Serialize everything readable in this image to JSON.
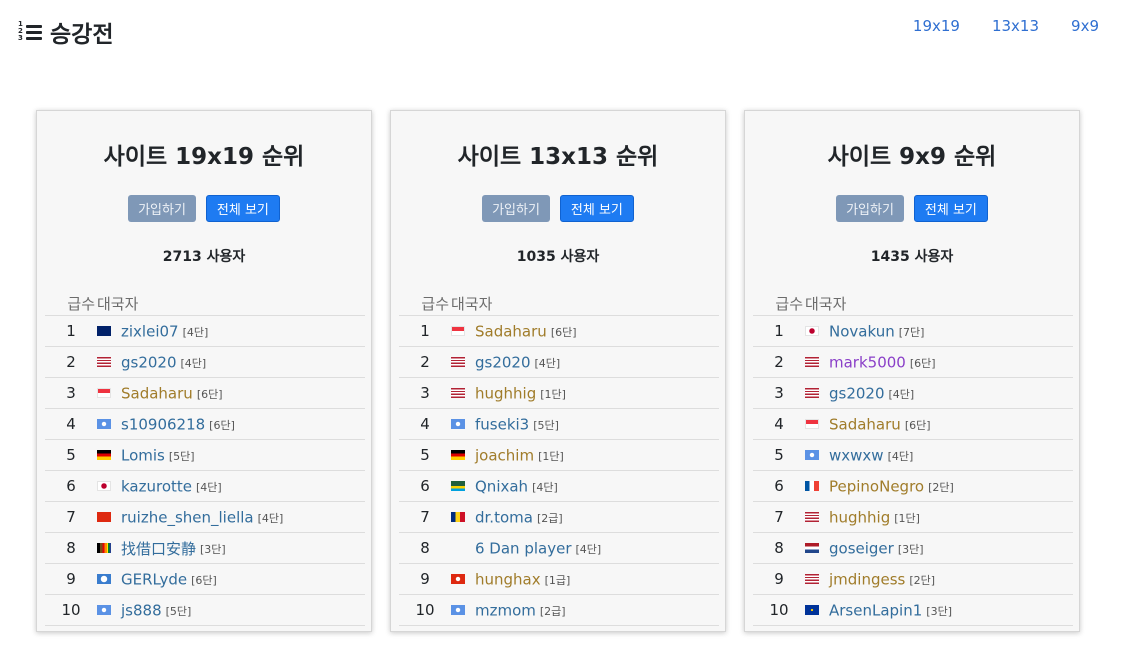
{
  "header": {
    "title": "승강전"
  },
  "nav": [
    "19x19",
    "13x13",
    "9x9"
  ],
  "buttons": {
    "join": "가입하기",
    "view_all": "전체 보기"
  },
  "table_headers": {
    "rank": "급수",
    "player": "대국자"
  },
  "colors": {
    "link_blue": "#336d9c",
    "gold": "#a07c2a",
    "purple": "#8a3fc8"
  },
  "panels": [
    {
      "title": "사이트 19x19 순위",
      "user_count": "2713 사용자",
      "rows": [
        {
          "rank": "1",
          "flag": "au",
          "name": "zixlei07",
          "grade": "[4단]",
          "color": "blue"
        },
        {
          "rank": "2",
          "flag": "us",
          "name": "gs2020",
          "grade": "[4단]",
          "color": "blue"
        },
        {
          "rank": "3",
          "flag": "sg",
          "name": "Sadaharu",
          "grade": "[6단]",
          "color": "gold"
        },
        {
          "rank": "4",
          "flag": "un",
          "name": "s10906218",
          "grade": "[6단]",
          "color": "blue"
        },
        {
          "rank": "5",
          "flag": "de",
          "name": "Lomis",
          "grade": "[5단]",
          "color": "blue"
        },
        {
          "rank": "6",
          "flag": "jp",
          "name": "kazurotte",
          "grade": "[4단]",
          "color": "blue"
        },
        {
          "rank": "7",
          "flag": "cn",
          "name": "ruizhe_shen_liella",
          "grade": "[4단]",
          "color": "blue"
        },
        {
          "rank": "8",
          "flag": "pride",
          "name": "找借口安静",
          "grade": "[3단]",
          "color": "blue"
        },
        {
          "rank": "9",
          "flag": "aq",
          "name": "GERLyde",
          "grade": "[6단]",
          "color": "blue"
        },
        {
          "rank": "10",
          "flag": "un",
          "name": "js888",
          "grade": "[5단]",
          "color": "blue"
        }
      ]
    },
    {
      "title": "사이트 13x13 순위",
      "user_count": "1035 사용자",
      "rows": [
        {
          "rank": "1",
          "flag": "sg",
          "name": "Sadaharu",
          "grade": "[6단]",
          "color": "gold"
        },
        {
          "rank": "2",
          "flag": "us",
          "name": "gs2020",
          "grade": "[4단]",
          "color": "blue"
        },
        {
          "rank": "3",
          "flag": "us",
          "name": "hughhig",
          "grade": "[1단]",
          "color": "gold"
        },
        {
          "rank": "4",
          "flag": "un",
          "name": "fuseki3",
          "grade": "[5단]",
          "color": "blue"
        },
        {
          "rank": "5",
          "flag": "de",
          "name": "joachim",
          "grade": "[1단]",
          "color": "gold"
        },
        {
          "rank": "6",
          "flag": "rw",
          "name": "Qnixah",
          "grade": "[4단]",
          "color": "blue"
        },
        {
          "rank": "7",
          "flag": "ro",
          "name": "dr.toma",
          "grade": "[2급]",
          "color": "blue"
        },
        {
          "rank": "8",
          "flag": "none",
          "name": "6 Dan player",
          "grade": "[4단]",
          "color": "blue"
        },
        {
          "rank": "9",
          "flag": "hk",
          "name": "hunghax",
          "grade": "[1급]",
          "color": "gold"
        },
        {
          "rank": "10",
          "flag": "un",
          "name": "mzmom",
          "grade": "[2급]",
          "color": "blue"
        }
      ]
    },
    {
      "title": "사이트 9x9 순위",
      "user_count": "1435 사용자",
      "rows": [
        {
          "rank": "1",
          "flag": "jp",
          "name": "Novakun",
          "grade": "[7단]",
          "color": "blue"
        },
        {
          "rank": "2",
          "flag": "us",
          "name": "mark5000",
          "grade": "[6단]",
          "color": "purple"
        },
        {
          "rank": "3",
          "flag": "us",
          "name": "gs2020",
          "grade": "[4단]",
          "color": "blue"
        },
        {
          "rank": "4",
          "flag": "sg",
          "name": "Sadaharu",
          "grade": "[6단]",
          "color": "gold"
        },
        {
          "rank": "5",
          "flag": "un",
          "name": "wxwxw",
          "grade": "[4단]",
          "color": "blue"
        },
        {
          "rank": "6",
          "flag": "fr",
          "name": "PepinoNegro",
          "grade": "[2단]",
          "color": "gold"
        },
        {
          "rank": "7",
          "flag": "us",
          "name": "hughhig",
          "grade": "[1단]",
          "color": "gold"
        },
        {
          "rank": "8",
          "flag": "nl",
          "name": "goseiger",
          "grade": "[3단]",
          "color": "blue"
        },
        {
          "rank": "9",
          "flag": "us",
          "name": "jmdingess",
          "grade": "[2단]",
          "color": "gold"
        },
        {
          "rank": "10",
          "flag": "eu",
          "name": "ArsenLapin1",
          "grade": "[3단]",
          "color": "blue"
        }
      ]
    }
  ]
}
